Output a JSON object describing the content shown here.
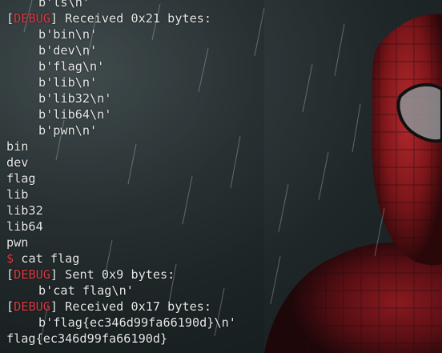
{
  "terminal": {
    "lines": [
      {
        "kind": "indent",
        "text": "b'ls\\n'"
      },
      {
        "kind": "debug",
        "tag": "DEBUG",
        "text": " Received 0x21 bytes:"
      },
      {
        "kind": "indent",
        "text": "b'bin\\n'"
      },
      {
        "kind": "indent",
        "text": "b'dev\\n'"
      },
      {
        "kind": "indent",
        "text": "b'flag\\n'"
      },
      {
        "kind": "indent",
        "text": "b'lib\\n'"
      },
      {
        "kind": "indent",
        "text": "b'lib32\\n'"
      },
      {
        "kind": "indent",
        "text": "b'lib64\\n'"
      },
      {
        "kind": "indent",
        "text": "b'pwn\\n'"
      },
      {
        "kind": "plain",
        "text": "bin"
      },
      {
        "kind": "plain",
        "text": "dev"
      },
      {
        "kind": "plain",
        "text": "flag"
      },
      {
        "kind": "plain",
        "text": "lib"
      },
      {
        "kind": "plain",
        "text": "lib32"
      },
      {
        "kind": "plain",
        "text": "lib64"
      },
      {
        "kind": "plain",
        "text": "pwn"
      },
      {
        "kind": "prompt",
        "prompt": "$",
        "text": " cat flag"
      },
      {
        "kind": "debug",
        "tag": "DEBUG",
        "text": " Sent 0x9 bytes:"
      },
      {
        "kind": "indent",
        "text": "b'cat flag\\n'"
      },
      {
        "kind": "debug",
        "tag": "DEBUG",
        "text": " Received 0x17 bytes:"
      },
      {
        "kind": "indent",
        "text": "b'flag{ec346d99fa66190d}\\n'"
      },
      {
        "kind": "plain",
        "text": "flag{ec346d99fa66190d}"
      }
    ]
  },
  "colors": {
    "text": "#e6e6e6",
    "accent_red": "#e0363f",
    "background": "#1b2224"
  },
  "background_image": "spiderman-in-rain-wallpaper"
}
